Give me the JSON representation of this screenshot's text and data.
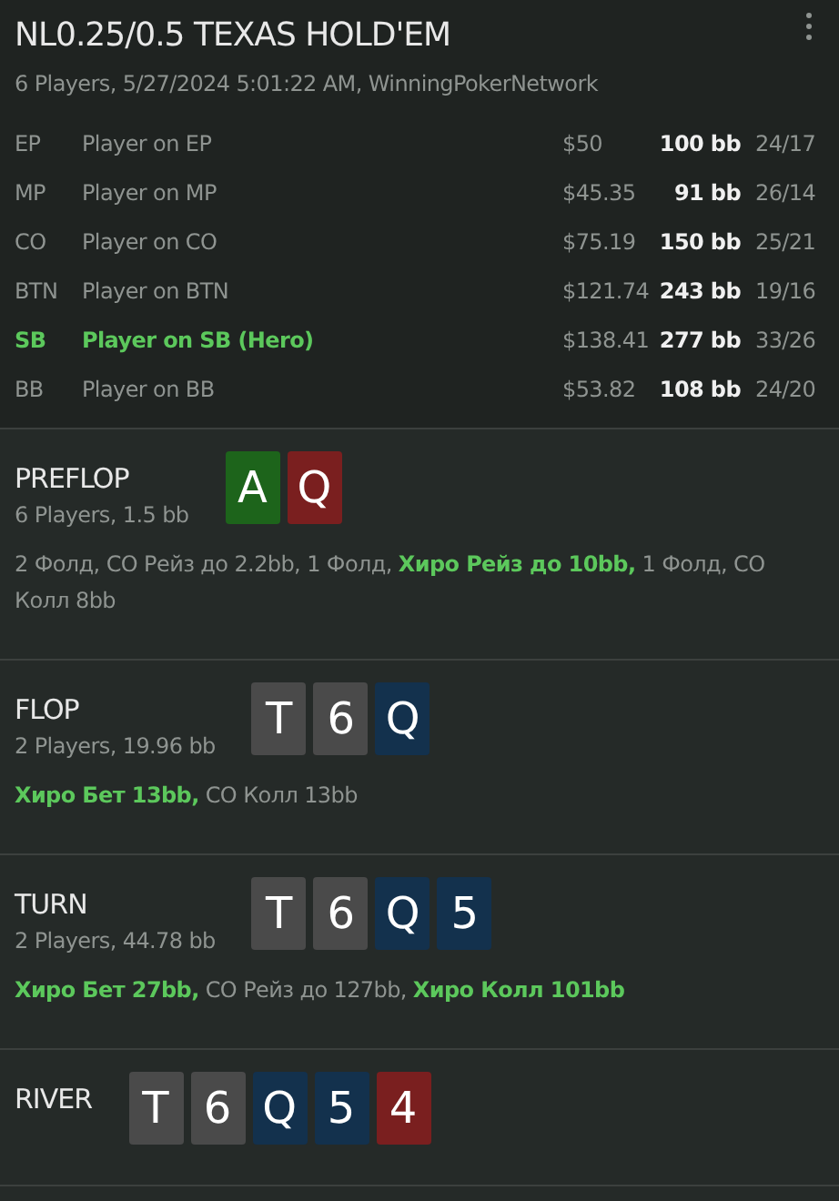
{
  "header": {
    "title": "NL0.25/0.5 TEXAS HOLD'EM",
    "subtitle": "6 Players, 5/27/2024 5:01:22 AM, WinningPokerNetwork"
  },
  "players": [
    {
      "position": "EP",
      "name": "Player on EP",
      "stack": "$50",
      "bb": "100 bb",
      "stats": "24/17",
      "hero": false
    },
    {
      "position": "MP",
      "name": "Player on MP",
      "stack": "$45.35",
      "bb": "91 bb",
      "stats": "26/14",
      "hero": false
    },
    {
      "position": "CO",
      "name": "Player on CO",
      "stack": "$75.19",
      "bb": "150 bb",
      "stats": "25/21",
      "hero": false
    },
    {
      "position": "BTN",
      "name": "Player on BTN",
      "stack": "$121.74",
      "bb": "243 bb",
      "stats": "19/16",
      "hero": false
    },
    {
      "position": "SB",
      "name": "Player on SB (Hero)",
      "stack": "$138.41",
      "bb": "277 bb",
      "stats": "33/26",
      "hero": true
    },
    {
      "position": "BB",
      "name": "Player on BB",
      "stack": "$53.82",
      "bb": "108 bb",
      "stats": "24/20",
      "hero": false
    }
  ],
  "streets": [
    {
      "name": "PREFLOP",
      "info": "6 Players, 1.5 bb",
      "cards": [
        {
          "rank": "A",
          "color": "#1d641b"
        },
        {
          "rank": "Q",
          "color": "#7a1f1f"
        }
      ],
      "actions": [
        {
          "text": "2 Фолд, CO Рейз до 2.2bb, 1 Фолд, ",
          "hero": false
        },
        {
          "text": "Хиро Рейз до 10bb,",
          "hero": true
        },
        {
          "text": " 1 Фолд, CO Колл 8bb",
          "hero": false
        }
      ]
    },
    {
      "name": "FLOP",
      "info": "2 Players, 19.96 bb",
      "cards": [
        {
          "rank": "T",
          "color": "#4a4a4a"
        },
        {
          "rank": "6",
          "color": "#4a4a4a"
        },
        {
          "rank": "Q",
          "color": "#13314d"
        }
      ],
      "actions": [
        {
          "text": "Хиро Бет 13bb,",
          "hero": true
        },
        {
          "text": " CO Колл 13bb",
          "hero": false
        }
      ]
    },
    {
      "name": "TURN",
      "info": "2 Players, 44.78 bb",
      "cards": [
        {
          "rank": "T",
          "color": "#4a4a4a"
        },
        {
          "rank": "6",
          "color": "#4a4a4a"
        },
        {
          "rank": "Q",
          "color": "#13314d"
        },
        {
          "rank": "5",
          "color": "#13314d"
        }
      ],
      "actions": [
        {
          "text": "Хиро Бет 27bb,",
          "hero": true
        },
        {
          "text": " CO Рейз до 127bb, ",
          "hero": false
        },
        {
          "text": "Хиро Колл 101bb",
          "hero": true
        }
      ]
    },
    {
      "name": "RIVER",
      "cards": [
        {
          "rank": "T",
          "color": "#4a4a4a"
        },
        {
          "rank": "6",
          "color": "#4a4a4a"
        },
        {
          "rank": "Q",
          "color": "#13314d"
        },
        {
          "rank": "5",
          "color": "#13314d"
        },
        {
          "rank": "4",
          "color": "#7a1f1f"
        }
      ]
    }
  ]
}
